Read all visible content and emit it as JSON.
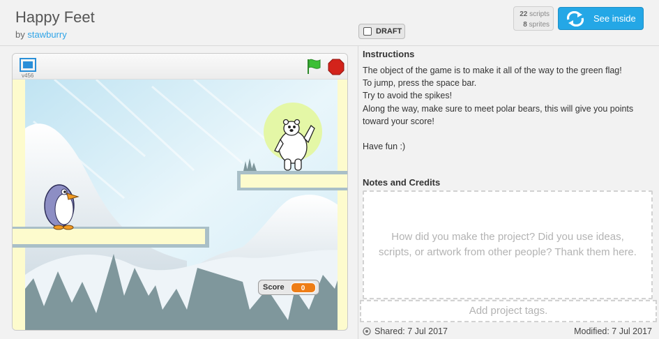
{
  "header": {
    "title": "Happy Feet",
    "by_label": "by",
    "author": "stawburry",
    "draft_label": "DRAFT",
    "scripts_count": "22",
    "scripts_label": "scripts",
    "sprites_count": "8",
    "sprites_label": "sprites",
    "see_inside_label": "See inside"
  },
  "player": {
    "version": "v456",
    "score_label": "Score",
    "score_value": "0"
  },
  "instructions": {
    "heading": "Instructions",
    "lines": [
      "The object of the game is to make it all of the way to the green flag!",
      "To jump, press the space bar.",
      "Try to avoid the spikes!",
      "Along the way, make sure to meet polar bears, this will give you points toward your score!",
      "Have fun :)"
    ]
  },
  "notes": {
    "heading": "Notes and Credits",
    "placeholder": "How did you make the project? Did you use ideas, scripts, or artwork from other people? Thank them here."
  },
  "tags": {
    "placeholder": "Add project tags."
  },
  "footer": {
    "shared": "Shared: 7 Jul 2017",
    "modified": "Modified: 7 Jul 2017"
  },
  "colors": {
    "accent": "#24a7e6",
    "flag": "#3cbf35",
    "stop": "#d3231b",
    "score_badge": "#ee7d16",
    "platform": "#fdfbcd"
  }
}
